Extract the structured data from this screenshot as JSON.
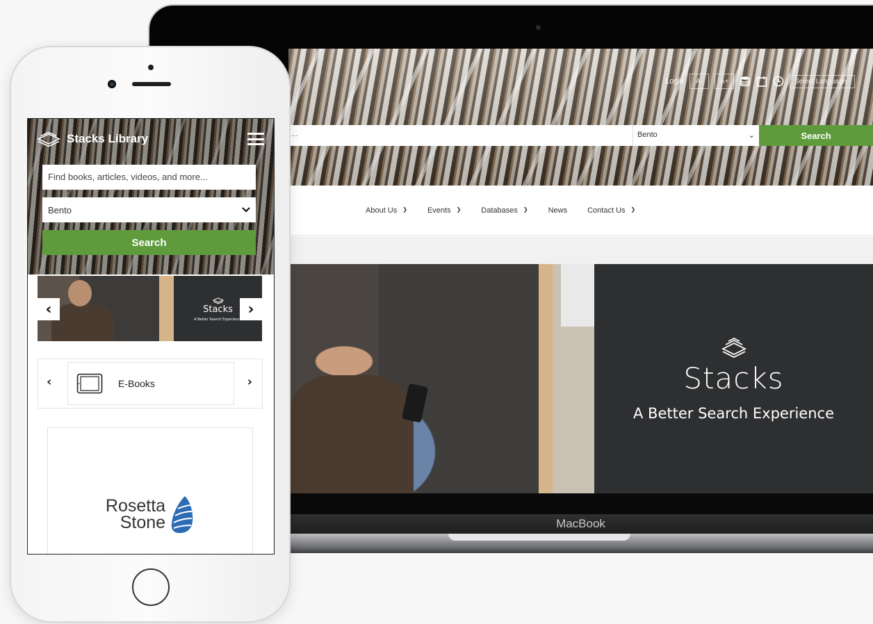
{
  "laptop": {
    "utility": {
      "login": "Login",
      "font_decrease": "A-",
      "font_increase": "A+",
      "language_select": "Select Language"
    },
    "search": {
      "input_text": "...",
      "select_value": "Bento",
      "button_label": "Search"
    },
    "nav": [
      {
        "label": "About Us",
        "has_dropdown": true
      },
      {
        "label": "Events",
        "has_dropdown": true
      },
      {
        "label": "Databases",
        "has_dropdown": true
      },
      {
        "label": "News",
        "has_dropdown": false
      },
      {
        "label": "Contact Us",
        "has_dropdown": true
      }
    ],
    "banner": {
      "brand": "Stacks",
      "tagline": "A Better Search Experience"
    },
    "device_label": "MacBook"
  },
  "phone": {
    "brand": "Stacks Library",
    "search_placeholder": "Find books, articles, videos, and more...",
    "select_value": "Bento",
    "search_button": "Search",
    "carousel": {
      "brand": "Stacks",
      "tagline": "A Better Search Experience",
      "prev_icon": "chevron-left-icon",
      "next_icon": "chevron-right-icon"
    },
    "category": {
      "label": "E-Books",
      "icon": "tablet-icon"
    },
    "partner": {
      "line1": "Rosetta",
      "line2": "Stone"
    }
  },
  "colors": {
    "accent_green": "#5f9b3d",
    "banner_dark": "#2e2f31"
  }
}
